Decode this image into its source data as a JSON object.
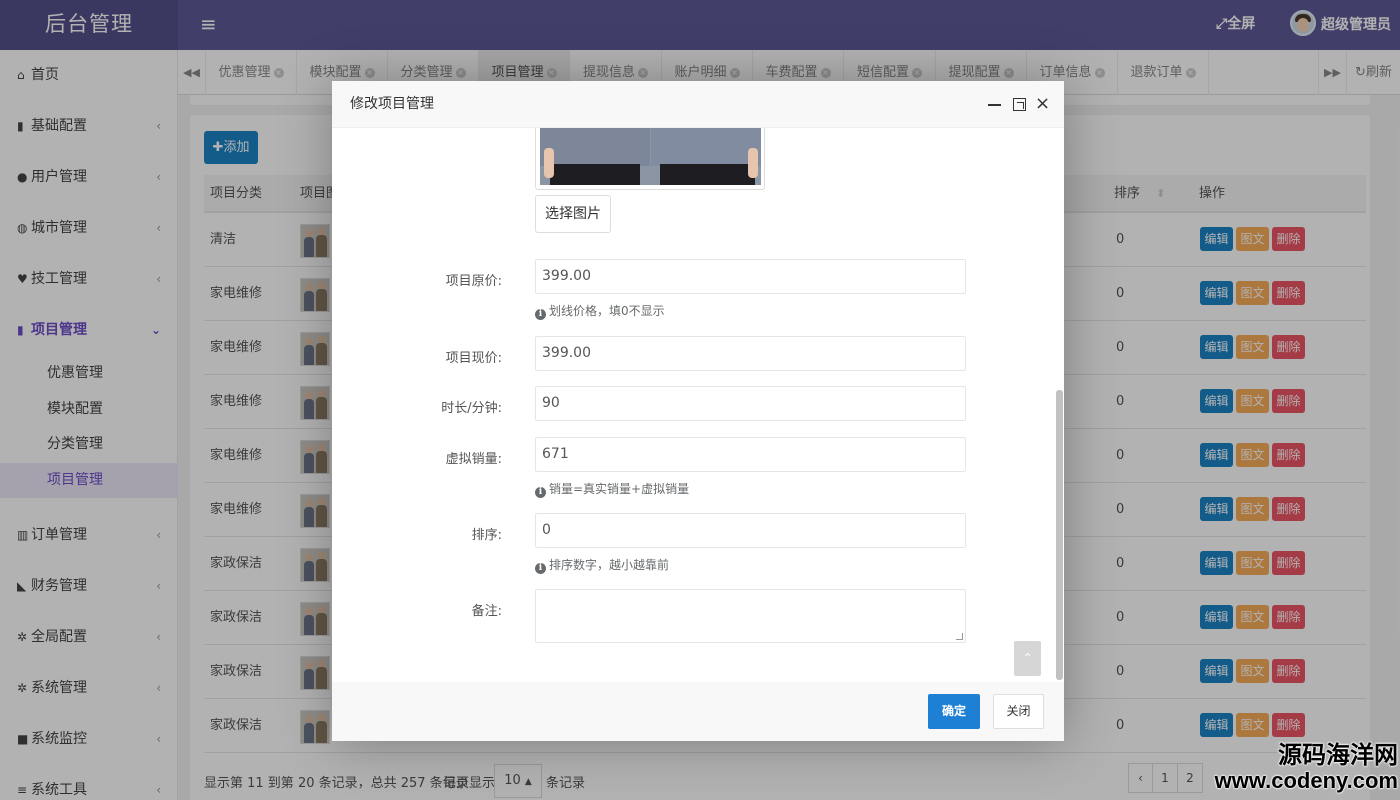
{
  "app": {
    "title": "后台管理",
    "fullscreen_label": "全屏",
    "user_name": "超级管理员"
  },
  "sidebar": {
    "items": [
      {
        "label": "首页",
        "icon": "home-icon",
        "glyph": "⌂",
        "has_arrow": false
      },
      {
        "label": "基础配置",
        "icon": "bookmark-icon",
        "glyph": "▮",
        "has_arrow": true
      },
      {
        "label": "用户管理",
        "icon": "user-icon",
        "glyph": "●",
        "has_arrow": true
      },
      {
        "label": "城市管理",
        "icon": "globe-icon",
        "glyph": "◍",
        "has_arrow": true
      },
      {
        "label": "技工管理",
        "icon": "heart-icon",
        "glyph": "♥",
        "has_arrow": true
      },
      {
        "label": "项目管理",
        "icon": "book-icon",
        "glyph": "▮",
        "has_arrow": true,
        "expanded": true
      },
      {
        "label": "订单管理",
        "icon": "bar-chart-icon",
        "glyph": "▥",
        "has_arrow": true
      },
      {
        "label": "财务管理",
        "icon": "area-chart-icon",
        "glyph": "◣",
        "has_arrow": true
      },
      {
        "label": "全局配置",
        "icon": "cogs-icon",
        "glyph": "✲",
        "has_arrow": true
      },
      {
        "label": "系统管理",
        "icon": "gear-icon",
        "glyph": "✲",
        "has_arrow": true
      },
      {
        "label": "系统监控",
        "icon": "video-camera-icon",
        "glyph": "■",
        "has_arrow": true
      },
      {
        "label": "系统工具",
        "icon": "bars-icon",
        "glyph": "≡",
        "has_arrow": true
      }
    ],
    "sub_items": [
      "优惠管理",
      "模块配置",
      "分类管理",
      "项目管理"
    ],
    "active_sub": "项目管理"
  },
  "tabs": {
    "items": [
      "优惠管理",
      "模块配置",
      "分类管理",
      "项目管理",
      "提现信息",
      "账户明细",
      "车费配置",
      "短信配置",
      "提现配置",
      "订单信息",
      "退款订单"
    ],
    "active": "项目管理",
    "refresh_label": "刷新"
  },
  "toolbar": {
    "add_label": "添加"
  },
  "table": {
    "headers": [
      "项目分类",
      "项目图",
      "排序",
      "操作"
    ],
    "rows": [
      {
        "category": "清洁",
        "sort": "0"
      },
      {
        "category": "家电维修",
        "sort": "0"
      },
      {
        "category": "家电维修",
        "sort": "0"
      },
      {
        "category": "家电维修",
        "sort": "0"
      },
      {
        "category": "家电维修",
        "sort": "0"
      },
      {
        "category": "家电维修",
        "sort": "0"
      },
      {
        "category": "家政保洁",
        "sort": "0"
      },
      {
        "category": "家政保洁",
        "sort": "0"
      },
      {
        "category": "家政保洁",
        "sort": "0"
      },
      {
        "category": "家政保洁",
        "sort": "0"
      }
    ],
    "actions": {
      "edit": "编辑",
      "image_text": "图文",
      "delete": "删除"
    }
  },
  "pagination": {
    "summary": "显示第 11 到第 20 条记录，总共 257 条记录",
    "per_page_prefix": "每页显示",
    "per_page_value": "10",
    "per_page_suffix": "条记录",
    "pages": [
      "‹",
      "1",
      "2"
    ]
  },
  "modal": {
    "title": "修改项目管理",
    "choose_image_label": "选择图片",
    "fields": {
      "original_price": {
        "label": "项目原价:",
        "value": "399.00",
        "help": "划线价格，填0不显示"
      },
      "current_price": {
        "label": "项目现价:",
        "value": "399.00"
      },
      "duration": {
        "label": "时长/分钟:",
        "value": "90"
      },
      "virtual_sales": {
        "label": "虚拟销量:",
        "value": "671",
        "help": "销量=真实销量+虚拟销量"
      },
      "sort": {
        "label": "排序:",
        "value": "0",
        "help": "排序数字，越小越靠前"
      },
      "remark": {
        "label": "备注:",
        "value": ""
      }
    },
    "confirm_label": "确定",
    "close_label": "关闭"
  },
  "watermark": {
    "line1": "源码海洋网",
    "line2": "www.codeny.com"
  },
  "colors": {
    "topbar": "#5d5a98",
    "accent": "#6d4dc8",
    "primary": "#1c84c6",
    "warning": "#f8ac59",
    "danger": "#ed5565",
    "confirm": "#1e80d4"
  }
}
